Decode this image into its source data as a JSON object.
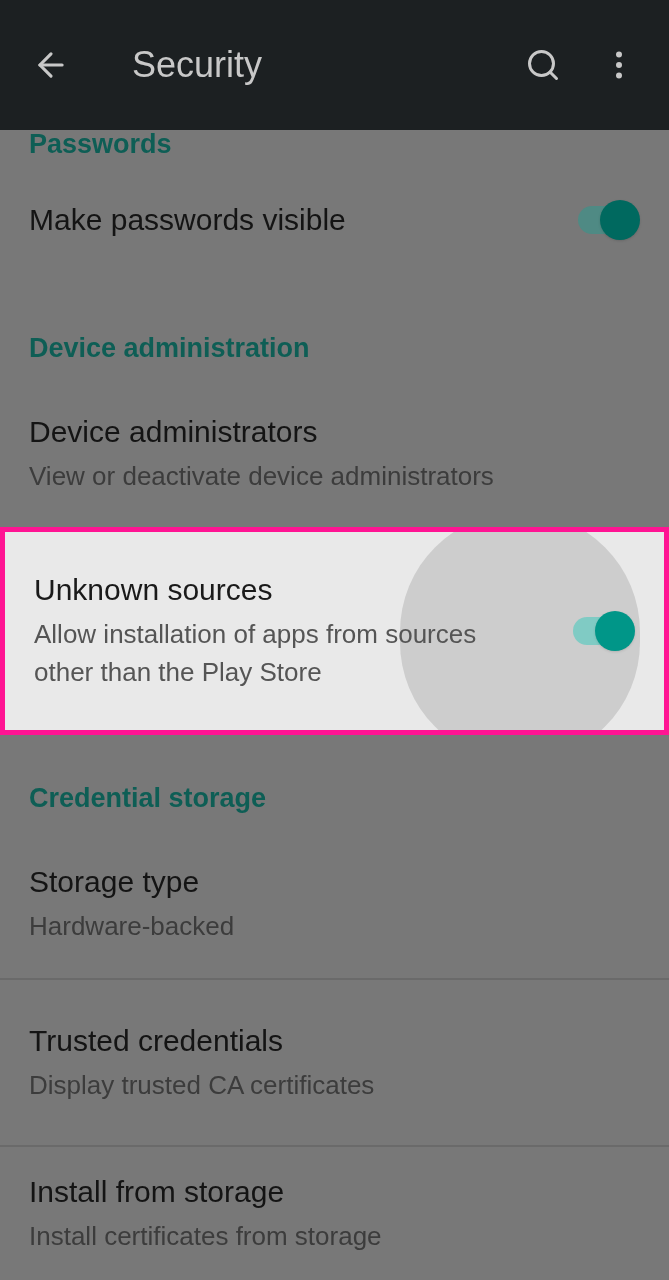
{
  "app_bar": {
    "title": "Security"
  },
  "items": [
    {
      "kind": "header",
      "title": "Passwords"
    },
    {
      "kind": "toggle",
      "title": "Make passwords visible",
      "on": true,
      "highlighted": false
    },
    {
      "kind": "header",
      "title": "Device administration"
    },
    {
      "kind": "item",
      "title": "Device administrators",
      "subtitle": "View or deactivate device administrators",
      "highlighted": false
    },
    {
      "kind": "toggle",
      "title": "Unknown sources",
      "subtitle": "Allow installation of apps from sources other than the Play Store",
      "on": true,
      "highlighted": true
    },
    {
      "kind": "header",
      "title": "Credential storage"
    },
    {
      "kind": "item",
      "title": "Storage type",
      "subtitle": "Hardware-backed",
      "highlighted": false
    },
    {
      "kind": "item",
      "title": "Trusted credentials",
      "subtitle": "Display trusted CA certificates",
      "highlighted": false
    },
    {
      "kind": "item",
      "title": "Install from storage",
      "subtitle": "Install certificates from storage",
      "highlighted": false
    }
  ]
}
